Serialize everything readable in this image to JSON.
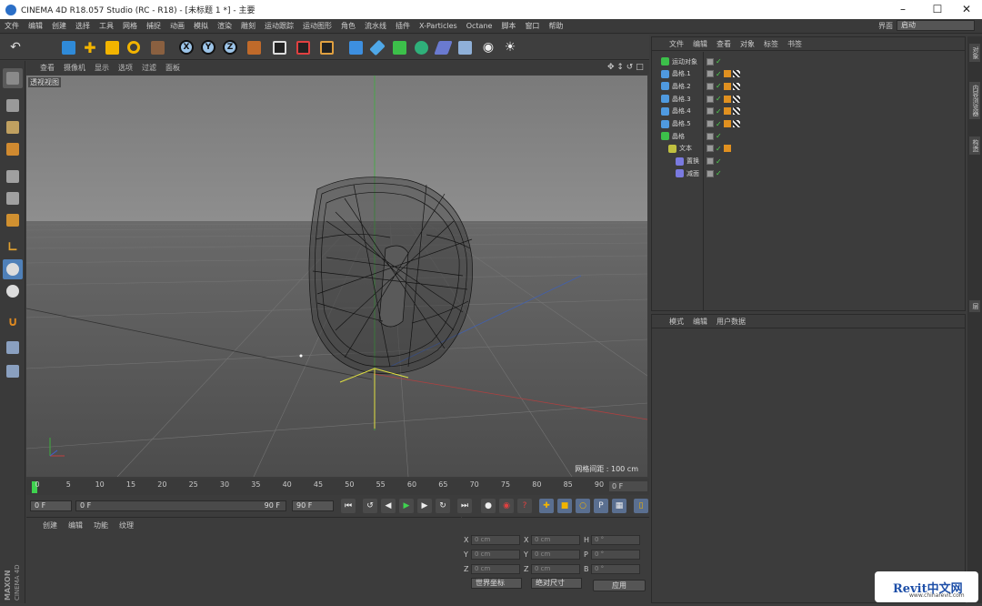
{
  "window": {
    "title": "CINEMA 4D R18.057 Studio (RC - R18) - [未标题 1 *] - 主要"
  },
  "menu": [
    "文件",
    "编辑",
    "创建",
    "选择",
    "工具",
    "网格",
    "捕捉",
    "动画",
    "模拟",
    "渲染",
    "雕刻",
    "运动跟踪",
    "运动图形",
    "角色",
    "流水线",
    "插件",
    "X-Particles",
    "Octane",
    "脚本",
    "窗口",
    "帮助"
  ],
  "layout_selector": {
    "label": "界面",
    "value": "启动"
  },
  "viewport": {
    "menu": [
      "查看",
      "摄像机",
      "显示",
      "选项",
      "过滤",
      "面板"
    ],
    "label": "透视视图",
    "grid_spacing": "网格间距 : 100 cm"
  },
  "timeline": {
    "ticks": [
      0,
      5,
      10,
      15,
      20,
      25,
      30,
      35,
      40,
      45,
      50,
      55,
      60,
      65,
      70,
      75,
      80,
      85,
      90
    ],
    "current_frame": "0 F"
  },
  "transport": {
    "start": "0 F",
    "range_start": "0 F",
    "range_end": "90 F",
    "end": "90 F"
  },
  "material_panel": {
    "menu": [
      "创建",
      "编辑",
      "功能",
      "纹理"
    ]
  },
  "coord_panel": {
    "rows": [
      {
        "a": "X",
        "v1": "0 cm",
        "b": "X",
        "v2": "0 cm",
        "c": "H",
        "v3": "0 °"
      },
      {
        "a": "Y",
        "v1": "0 cm",
        "b": "Y",
        "v2": "0 cm",
        "c": "P",
        "v3": "0 °"
      },
      {
        "a": "Z",
        "v1": "0 cm",
        "b": "Z",
        "v2": "0 cm",
        "c": "B",
        "v3": "0 °"
      }
    ],
    "mode_left": "世界坐标",
    "mode_right": "绝对尺寸",
    "apply": "应用"
  },
  "object_panel": {
    "menu": [
      "文件",
      "编辑",
      "查看",
      "对象",
      "标签",
      "书签"
    ],
    "objects": [
      {
        "name": "运动对象",
        "depth": 0
      },
      {
        "name": "晶格.1",
        "depth": 0
      },
      {
        "name": "晶格.2",
        "depth": 0
      },
      {
        "name": "晶格.3",
        "depth": 0
      },
      {
        "name": "晶格.4",
        "depth": 0
      },
      {
        "name": "晶格.5",
        "depth": 0
      },
      {
        "name": "晶格",
        "depth": 0
      },
      {
        "name": "文本",
        "depth": 1
      },
      {
        "name": "置换",
        "depth": 2
      },
      {
        "name": "减面",
        "depth": 2
      }
    ]
  },
  "attr_panel": {
    "menu": [
      "模式",
      "编辑",
      "用户数据"
    ]
  },
  "side_tabs": [
    "对象",
    "内容浏览器",
    "构造",
    "层"
  ],
  "maxon": {
    "brand": "MAXON",
    "product": "CINEMA 4D"
  },
  "watermark": {
    "brand": "Revit中文网",
    "url": "www.chinarevit.com"
  }
}
